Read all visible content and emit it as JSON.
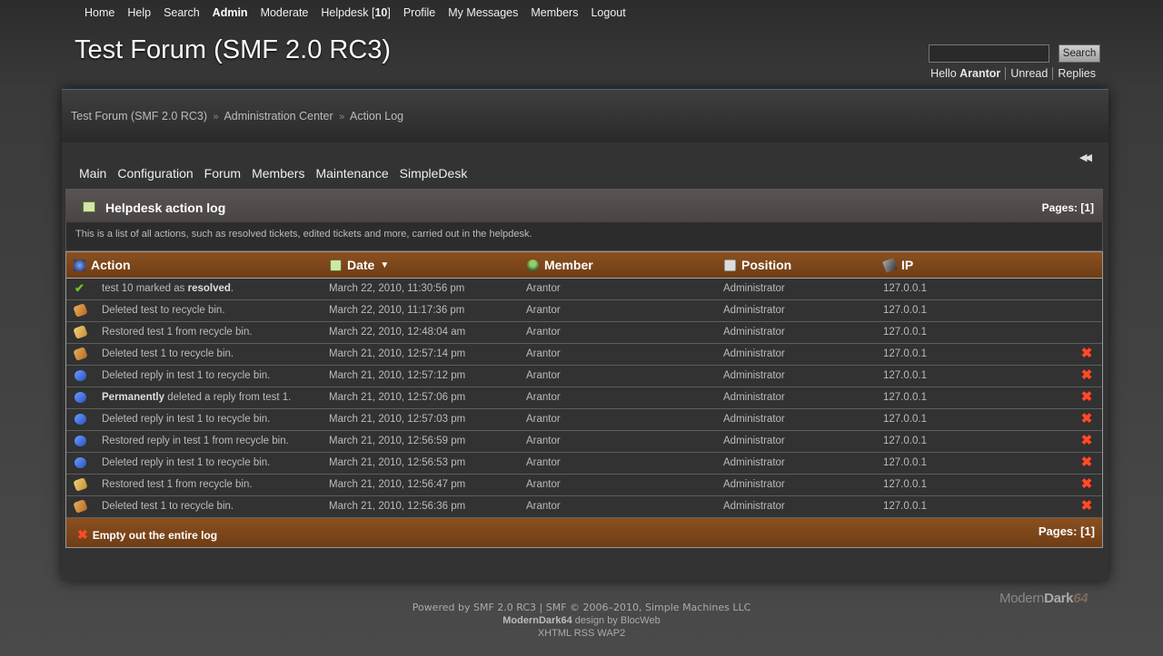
{
  "nav": {
    "items": [
      "Home",
      "Help",
      "Search",
      "Admin",
      "Moderate",
      "Helpdesk [",
      "Profile",
      "My Messages",
      "Members",
      "Logout"
    ],
    "helpdesk_count": "10",
    "helpdesk_close": "]"
  },
  "header": {
    "title": "Test Forum (SMF 2.0 RC3)",
    "search_button": "Search",
    "hello": "Hello",
    "username": "Arantor",
    "unread": "Unread",
    "replies": "Replies"
  },
  "breadcrumb": {
    "items": [
      "Test Forum (SMF 2.0 RC3)",
      "Administration Center",
      "Action Log"
    ],
    "separator": "»"
  },
  "admin_menu": [
    "Main",
    "Configuration",
    "Forum",
    "Members",
    "Maintenance",
    "SimpleDesk"
  ],
  "panel": {
    "title": "Helpdesk action log",
    "pages_top": "Pages: [1]",
    "description": "This is a list of all actions, such as resolved tickets, edited tickets and more, carried out in the helpdesk.",
    "columns": [
      "Action",
      "Date",
      "Member",
      "Position",
      "IP"
    ],
    "empty_log": "Empty out the entire log",
    "pages_bottom": "Pages: [1]"
  },
  "rows": [
    {
      "icon": "check",
      "pre": "test 10 marked as ",
      "bold": "resolved",
      "post": ".",
      "date": "March 22, 2010, 11:30:56 pm",
      "member": "Arantor",
      "position": "Administrator",
      "ip": "127.0.0.1",
      "deletable": false
    },
    {
      "icon": "tag",
      "pre": "Deleted test to recycle bin.",
      "bold": "",
      "post": "",
      "date": "March 22, 2010, 11:17:36 pm",
      "member": "Arantor",
      "position": "Administrator",
      "ip": "127.0.0.1",
      "deletable": false
    },
    {
      "icon": "tag-y",
      "pre": "Restored test 1 from recycle bin.",
      "bold": "",
      "post": "",
      "date": "March 22, 2010, 12:48:04 am",
      "member": "Arantor",
      "position": "Administrator",
      "ip": "127.0.0.1",
      "deletable": false
    },
    {
      "icon": "tag",
      "pre": "Deleted test 1 to recycle bin.",
      "bold": "",
      "post": "",
      "date": "March 21, 2010, 12:57:14 pm",
      "member": "Arantor",
      "position": "Administrator",
      "ip": "127.0.0.1",
      "deletable": true
    },
    {
      "icon": "post",
      "pre": "Deleted reply in test 1 to recycle bin.",
      "bold": "",
      "post": "",
      "date": "March 21, 2010, 12:57:12 pm",
      "member": "Arantor",
      "position": "Administrator",
      "ip": "127.0.0.1",
      "deletable": true
    },
    {
      "icon": "post",
      "pre": "",
      "bold": "Permanently",
      "post": " deleted a reply from test 1.",
      "date": "March 21, 2010, 12:57:06 pm",
      "member": "Arantor",
      "position": "Administrator",
      "ip": "127.0.0.1",
      "deletable": true
    },
    {
      "icon": "post",
      "pre": "Deleted reply in test 1 to recycle bin.",
      "bold": "",
      "post": "",
      "date": "March 21, 2010, 12:57:03 pm",
      "member": "Arantor",
      "position": "Administrator",
      "ip": "127.0.0.1",
      "deletable": true
    },
    {
      "icon": "post",
      "pre": "Restored reply in test 1 from recycle bin.",
      "bold": "",
      "post": "",
      "date": "March 21, 2010, 12:56:59 pm",
      "member": "Arantor",
      "position": "Administrator",
      "ip": "127.0.0.1",
      "deletable": true
    },
    {
      "icon": "post",
      "pre": "Deleted reply in test 1 to recycle bin.",
      "bold": "",
      "post": "",
      "date": "March 21, 2010, 12:56:53 pm",
      "member": "Arantor",
      "position": "Administrator",
      "ip": "127.0.0.1",
      "deletable": true
    },
    {
      "icon": "tag-y",
      "pre": "Restored test 1 from recycle bin.",
      "bold": "",
      "post": "",
      "date": "March 21, 2010, 12:56:47 pm",
      "member": "Arantor",
      "position": "Administrator",
      "ip": "127.0.0.1",
      "deletable": true
    },
    {
      "icon": "tag",
      "pre": "Deleted test 1 to recycle bin.",
      "bold": "",
      "post": "",
      "date": "March 21, 2010, 12:56:36 pm",
      "member": "Arantor",
      "position": "Administrator",
      "ip": "127.0.0.1",
      "deletable": true
    }
  ],
  "footer": {
    "line1": "Powered by SMF 2.0 RC3 | SMF © 2006–2010, Simple Machines LLC",
    "theme_name": "ModernDark64",
    "design_by": "design by",
    "designer": "BlocWeb",
    "line3": "XHTML RSS WAP2"
  },
  "theme_logo": {
    "part1": "Modern",
    "part2": "Dark",
    "part3": "64"
  },
  "colors": {
    "accent_header": "#7a451a",
    "delete": "#ff4a2a"
  }
}
